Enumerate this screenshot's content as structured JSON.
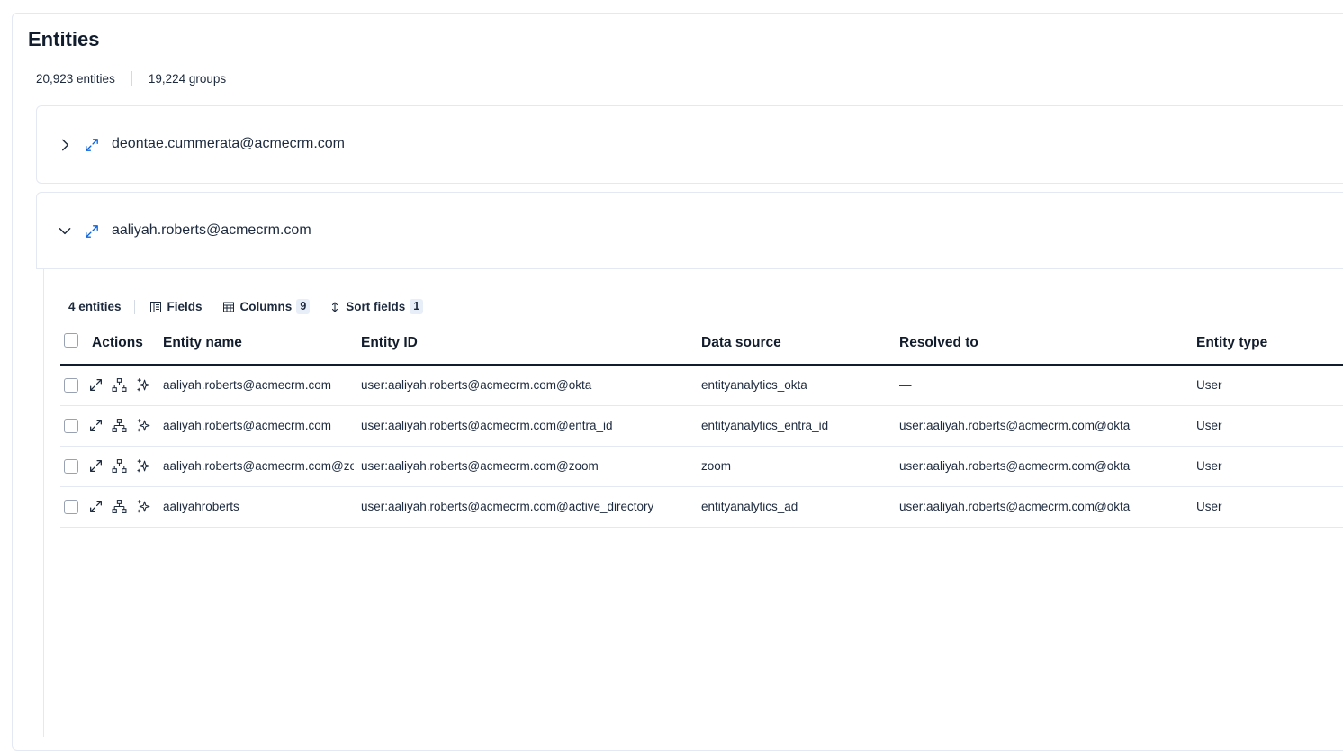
{
  "page": {
    "title": "Entities"
  },
  "stats": {
    "entities": "20,923 entities",
    "groups": "19,224 groups"
  },
  "groups": [
    {
      "name": "deontae.cummerata@acmecrm.com",
      "expanded": false
    },
    {
      "name": "aaliyah.roberts@acmecrm.com",
      "expanded": true
    }
  ],
  "toolbar": {
    "count": "4 entities",
    "fields_label": "Fields",
    "columns_label": "Columns",
    "columns_count": "9",
    "sort_label": "Sort fields",
    "sort_count": "1"
  },
  "table": {
    "headers": [
      "Actions",
      "Entity name",
      "Entity ID",
      "Data source",
      "Resolved to",
      "Entity type"
    ],
    "rows": [
      {
        "name": "aaliyah.roberts@acmecrm.com",
        "id": "user:aaliyah.roberts@acmecrm.com@okta",
        "source": "entityanalytics_okta",
        "resolved": "—",
        "type": "User"
      },
      {
        "name": "aaliyah.roberts@acmecrm.com",
        "id": "user:aaliyah.roberts@acmecrm.com@entra_id",
        "source": "entityanalytics_entra_id",
        "resolved": "user:aaliyah.roberts@acmecrm.com@okta",
        "type": "User"
      },
      {
        "name": "aaliyah.roberts@acmecrm.com@zoom",
        "id": "user:aaliyah.roberts@acmecrm.com@zoom",
        "source": "zoom",
        "resolved": "user:aaliyah.roberts@acmecrm.com@okta",
        "type": "User"
      },
      {
        "name": "aaliyahroberts",
        "id": "user:aaliyah.roberts@acmecrm.com@active_directory",
        "source": "entityanalytics_ad",
        "resolved": "user:aaliyah.roberts@acmecrm.com@okta",
        "type": "User"
      }
    ]
  },
  "colors": {
    "accent": "#0b64dd",
    "text": "#1d2a3e",
    "border": "#e3e8f2"
  }
}
